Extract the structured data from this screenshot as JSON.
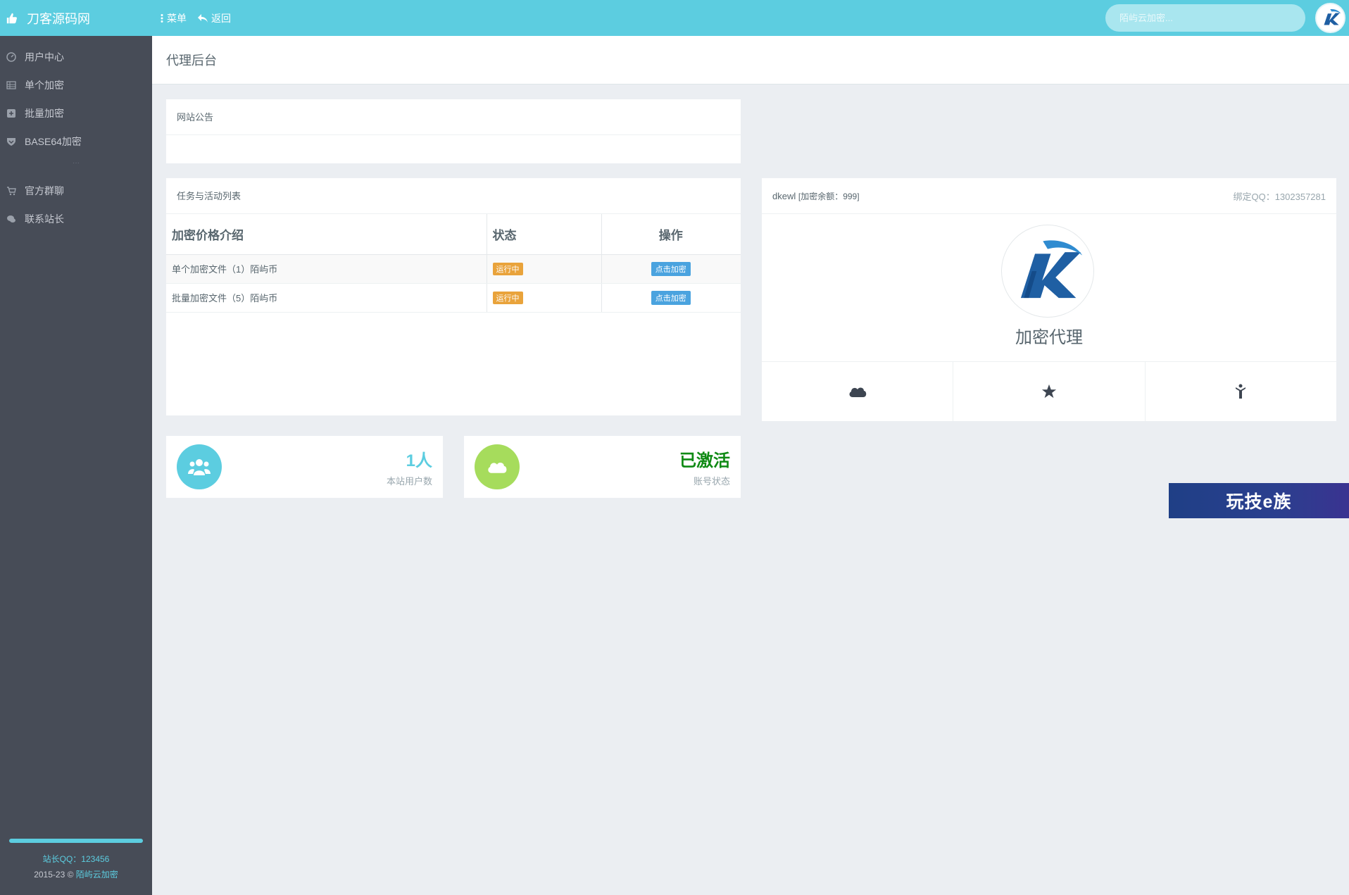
{
  "header": {
    "brand": "刀客源码网",
    "menu_label": "菜单",
    "back_label": "返回",
    "search_placeholder": "陌屿云加密..."
  },
  "sidebar": {
    "items": [
      {
        "label": "用户中心",
        "icon": "dashboard-icon"
      },
      {
        "label": "单个加密",
        "icon": "table-icon"
      },
      {
        "label": "批量加密",
        "icon": "plus-square-icon"
      },
      {
        "label": "BASE64加密",
        "icon": "shield-icon"
      },
      {
        "label": "官方群聊",
        "icon": "cart-icon"
      },
      {
        "label": "联系站长",
        "icon": "chat-icon"
      }
    ],
    "separator": "···",
    "footer_qq": "站长QQ：123456",
    "footer_copy": "2015-23 © ",
    "footer_link": "陌屿云加密"
  },
  "page": {
    "title": "代理后台"
  },
  "notice": {
    "title": "网站公告"
  },
  "tasks": {
    "title": "任务与活动列表",
    "headers": [
      "加密价格介绍",
      "状态",
      "操作"
    ],
    "rows": [
      {
        "name": "单个加密文件（1）陌屿币",
        "status": "运行中",
        "action": "点击加密"
      },
      {
        "name": "批量加密文件（5）陌屿币",
        "status": "运行中",
        "action": "点击加密"
      }
    ]
  },
  "profile": {
    "username": "dkewl",
    "balance_text": "[加密余额：999]",
    "qq_text": "绑定QQ：1302357281",
    "role": "加密代理"
  },
  "stats": [
    {
      "value": "1人",
      "label": "本站用户数",
      "color": "#5ccde0"
    },
    {
      "value": "已激活",
      "label": "账号状态",
      "color": "#0f8a14"
    }
  ],
  "promo": {
    "text": "玩技e族"
  },
  "colors": {
    "accent": "#5ccde0",
    "sidebar_bg": "#474c57",
    "warning": "#e9a33b",
    "info": "#4aa3df",
    "success_circle": "#a6dc5c"
  }
}
